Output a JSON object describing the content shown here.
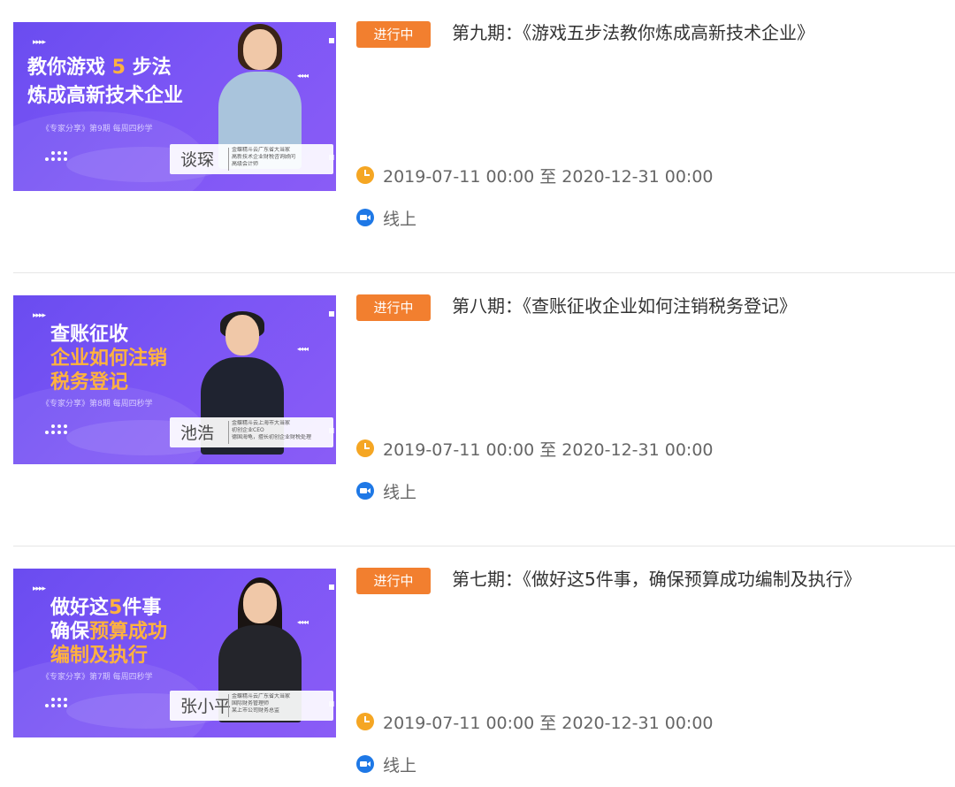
{
  "items": [
    {
      "status": "进行中",
      "title": "第九期：《游戏五步法教你炼成高新技术企业》",
      "time": "2019-07-11 00:00 至 2020-12-31 00:00",
      "location": "线上",
      "thumb": {
        "line1_pre": "教你游戏 ",
        "line1_hl": "5",
        "line1_post": " 步法",
        "line2": "炼成高新技术企业",
        "line3": "",
        "tag": "《专家分享》第9期 每周四秒学",
        "person_name": "谈琛",
        "person_desc": [
          "金蝶精斗云广东省大当家",
          "高新技术企业财税咨询顾问",
          "高级会计师"
        ]
      }
    },
    {
      "status": "进行中",
      "title": "第八期：《查账征收企业如何注销税务登记》",
      "time": "2019-07-11 00:00 至 2020-12-31 00:00",
      "location": "线上",
      "thumb": {
        "line1_pre": "查账征收",
        "line1_hl": "",
        "line1_post": "",
        "line2": "企业如何注销",
        "line3": "税务登记",
        "tag": "《专家分享》第8期 每周四秒学",
        "person_name": "池浩",
        "person_desc": [
          "金蝶精斗云上海市大当家",
          "初创企业CEO",
          "德国海龟，擅长初创企业财税处理"
        ]
      }
    },
    {
      "status": "进行中",
      "title": "第七期：《做好这5件事，确保预算成功编制及执行》",
      "time": "2019-07-11 00:00 至 2020-12-31 00:00",
      "location": "线上",
      "thumb": {
        "line1_pre": "做好这",
        "line1_hl": "5",
        "line1_post": "件事",
        "line2_pre": "确保",
        "line2_hl": "预算成功",
        "line3": "编制及执行",
        "tag": "《专家分享》第7期 每周四秒学",
        "person_name": "张小平",
        "person_desc": [
          "金蝶精斗云广东省大当家",
          "国际财务管理师",
          "某上市公司财务总监"
        ]
      }
    }
  ],
  "colors": {
    "badge": "#f27f2f",
    "thumb_bg": "#7b55f5",
    "highlight": "#ffb23f",
    "clock_icon": "#f5a623",
    "camera_icon": "#1e78e6"
  },
  "icons": [
    "clock-icon",
    "camera-icon"
  ]
}
